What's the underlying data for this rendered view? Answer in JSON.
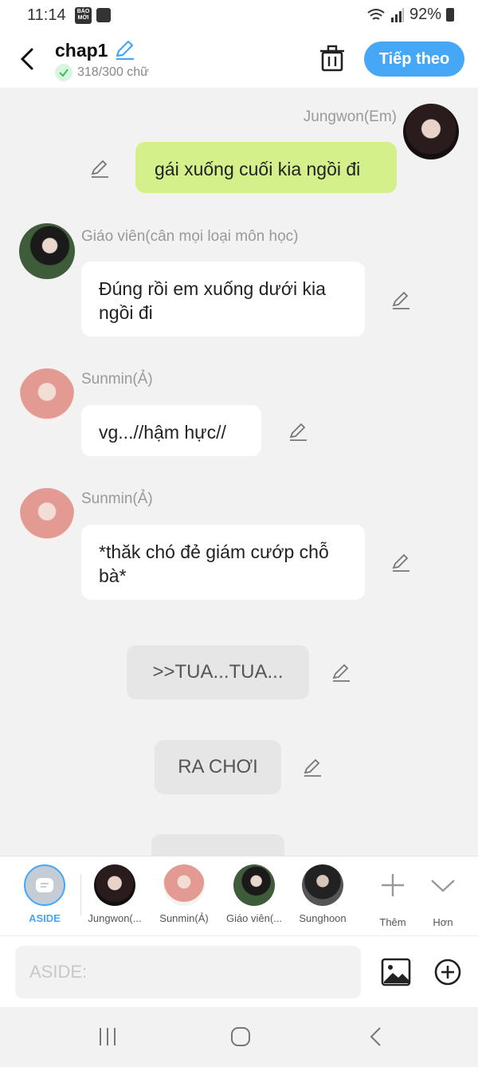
{
  "status_bar": {
    "time": "11:14",
    "news_badge": "BÁO MỚI",
    "battery": "92%"
  },
  "header": {
    "title": "chap1",
    "word_count": "318/300 chữ",
    "next_label": "Tiếp theo"
  },
  "messages": [
    {
      "speaker": "Jungwon(Em)",
      "text": "gái xuống cuối kia ngồi đi",
      "side": "right"
    },
    {
      "speaker": "Giáo viên(cân mọi loại môn học)",
      "text": "Đúng rồi em xuống dưới kia ngồi đi",
      "side": "left"
    },
    {
      "speaker": "Sunmin(Ả)",
      "text": "vg...//hậm hực//",
      "side": "left"
    },
    {
      "speaker": "Sunmin(Ả)",
      "text": "*thăk chó đẻ giám cướp chỗ bà*",
      "side": "left"
    },
    {
      "speaker": "",
      "text": ">>TUA...TUA...",
      "side": "aside"
    },
    {
      "speaker": "",
      "text": "RA CHƠI",
      "side": "aside"
    }
  ],
  "characters": [
    {
      "label": "ASIDE"
    },
    {
      "label": "Jungwon(..."
    },
    {
      "label": "Sunmin(Ả)"
    },
    {
      "label": "Giáo viên(..."
    },
    {
      "label": "Sunghoon"
    },
    {
      "label": "Thêm"
    },
    {
      "label": "Hơn"
    }
  ],
  "input": {
    "placeholder": "ASIDE:"
  },
  "colors": {
    "accent": "#45a7f5",
    "own_bubble": "#d4f08a",
    "background": "#f2f2f2"
  }
}
